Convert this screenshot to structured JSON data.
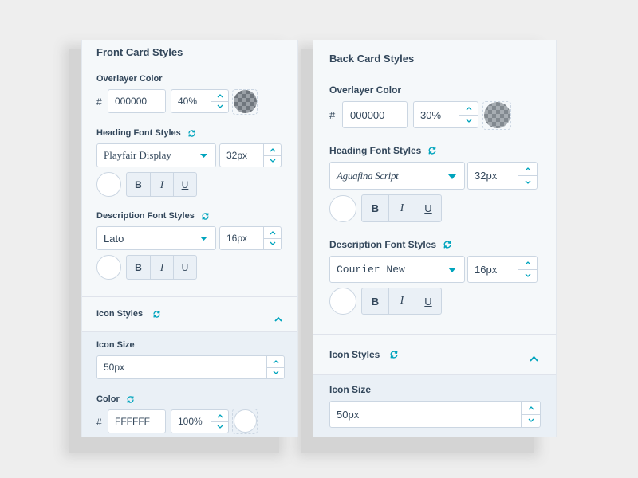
{
  "front": {
    "title": "Front Card Styles",
    "overlayer": {
      "label": "Overlayer Color",
      "hash": "#",
      "hex": "000000",
      "opacity": "40%"
    },
    "heading": {
      "label": "Heading Font Styles",
      "font": "Playfair Display",
      "size": "32px",
      "bold": "B",
      "italic": "I",
      "underline": "U"
    },
    "description": {
      "label": "Description Font Styles",
      "font": "Lato",
      "size": "16px",
      "bold": "B",
      "italic": "I",
      "underline": "U"
    },
    "icon_styles": {
      "label": "Icon Styles"
    },
    "icon_size": {
      "label": "Icon Size",
      "value": "50px"
    },
    "color": {
      "label": "Color",
      "hash": "#",
      "hex": "FFFFFF",
      "opacity": "100%"
    }
  },
  "back": {
    "title": "Back Card Styles",
    "overlayer": {
      "label": "Overlayer Color",
      "hash": "#",
      "hex": "000000",
      "opacity": "30%"
    },
    "heading": {
      "label": "Heading Font Styles",
      "font": "Aguafina Script",
      "size": "32px",
      "bold": "B",
      "italic": "I",
      "underline": "U"
    },
    "description": {
      "label": "Description Font Styles",
      "font": "Courier New",
      "size": "16px",
      "bold": "B",
      "italic": "I",
      "underline": "U"
    },
    "icon_styles": {
      "label": "Icon Styles"
    },
    "icon_size": {
      "label": "Icon Size",
      "value": "50px"
    }
  },
  "colors": {
    "accent": "#00a4bd",
    "text": "#33475b",
    "border": "#cbd6e2",
    "panel": "#f5f8fa",
    "section": "#eaf0f6"
  },
  "icons": {
    "sync": "sync-icon",
    "caret": "caret-down-icon",
    "chevron": "chevron-up-icon"
  }
}
